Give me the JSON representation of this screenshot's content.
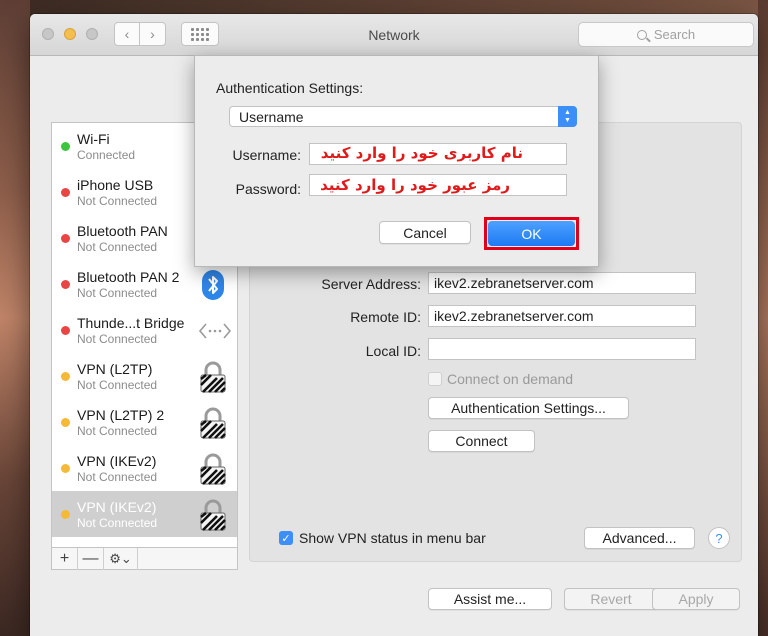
{
  "window": {
    "title": "Network",
    "search_placeholder": "Search"
  },
  "sidebar": {
    "services": [
      {
        "name": "Wi-Fi",
        "status": "Connected",
        "dot_color": "#3ec43e",
        "icon": ""
      },
      {
        "name": "iPhone USB",
        "status": "Not Connected",
        "dot_color": "#e84545",
        "icon": ""
      },
      {
        "name": "Bluetooth PAN",
        "status": "Not Connected",
        "dot_color": "#e84545",
        "icon": ""
      },
      {
        "name": "Bluetooth PAN 2",
        "status": "Not Connected",
        "dot_color": "#e84545",
        "icon": "bluetooth-icon"
      },
      {
        "name": "Thunde...t Bridge",
        "status": "Not Connected",
        "dot_color": "#e84545",
        "icon": "thunderbolt-bridge-icon"
      },
      {
        "name": "VPN (L2TP)",
        "status": "Not Connected",
        "dot_color": "#f5b93a",
        "icon": "vpn-lock-icon"
      },
      {
        "name": "VPN (L2TP) 2",
        "status": "Not Connected",
        "dot_color": "#f5b93a",
        "icon": "vpn-lock-icon"
      },
      {
        "name": "VPN (IKEv2)",
        "status": "Not Connected",
        "dot_color": "#f5b93a",
        "icon": "vpn-lock-icon"
      },
      {
        "name": "VPN (IKEv2)",
        "status": "Not Connected",
        "dot_color": "#f5b93a",
        "icon": "vpn-lock-icon",
        "selected": true
      }
    ],
    "tools": {
      "add": "+",
      "remove": "—",
      "gear": "⚙︎⌄"
    }
  },
  "details": {
    "server_address_label": "Server Address:",
    "server_address_value": "ikev2.zebranetserver.com",
    "remote_id_label": "Remote ID:",
    "remote_id_value": "ikev2.zebranetserver.com",
    "local_id_label": "Local ID:",
    "local_id_value": "",
    "connect_on_demand_label": "Connect on demand",
    "auth_settings_button": "Authentication Settings...",
    "connect_button": "Connect",
    "show_vpn_status_label": "Show VPN status in menu bar",
    "advanced_button": "Advanced...",
    "help_button": "?"
  },
  "footer": {
    "assist_button": "Assist me...",
    "revert_button": "Revert",
    "apply_button": "Apply"
  },
  "sheet": {
    "title": "Authentication Settings:",
    "method_selected": "Username",
    "username_label": "Username:",
    "username_annotation": "نام کاربری خود را وارد کنید",
    "password_label": "Password:",
    "password_annotation": "رمز عبور خود را وارد کنید",
    "cancel_button": "Cancel",
    "ok_button": "OK"
  },
  "colors": {
    "accent": "#3b8ff6",
    "highlight_outline": "#e1001a",
    "annotation_text": "#e01a1a"
  }
}
